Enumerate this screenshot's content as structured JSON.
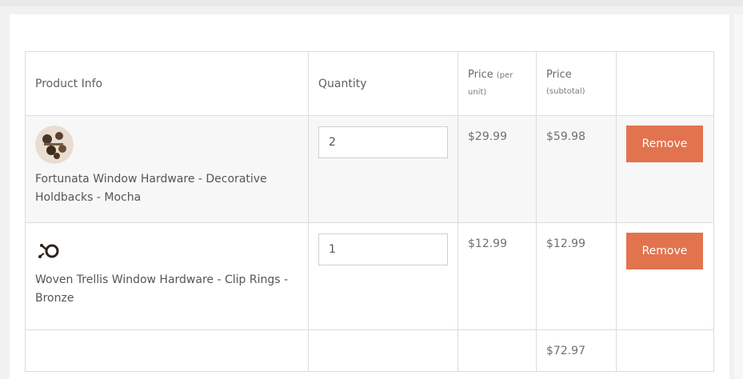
{
  "cart": {
    "headers": {
      "product": "Product Info",
      "quantity": "Quantity",
      "price_unit_main": "Price",
      "price_unit_sub": "(per unit)",
      "price_subtotal_main": "Price",
      "price_subtotal_sub": "(subtotal)"
    },
    "items": [
      {
        "name": "Fortunata Window Hardware - Decorative Holdbacks - Mocha",
        "quantity": "2",
        "unit_price": "$29.99",
        "subtotal": "$59.98",
        "remove_label": "Remove",
        "image_icon": "decorative-holdbacks-image"
      },
      {
        "name": "Woven Trellis Window Hardware - Clip Rings - Bronze",
        "quantity": "1",
        "unit_price": "$12.99",
        "subtotal": "$12.99",
        "remove_label": "Remove",
        "image_icon": "clip-rings-image"
      }
    ],
    "total": "$72.97"
  },
  "colors": {
    "remove_button": "#e2734f",
    "row_alt": "#f7f7f7",
    "border": "#dcdcdc"
  }
}
